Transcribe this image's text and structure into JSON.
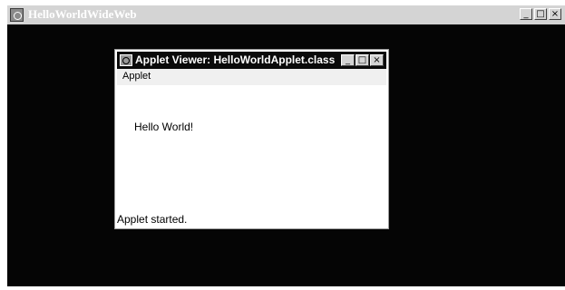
{
  "outer_window": {
    "title": "HelloWorldWideWeb",
    "icon": "java-cup-icon",
    "controls": {
      "minimize": "_",
      "maximize": "□",
      "close": "×"
    }
  },
  "applet_viewer": {
    "title": "Applet Viewer: HelloWorldApplet.class",
    "icon": "java-cup-icon",
    "controls": {
      "minimize": "_",
      "maximize": "□",
      "close": "×"
    },
    "menu": [
      "Applet"
    ],
    "content_text": "Hello World!",
    "status": "Applet started."
  },
  "colors": {
    "outer_background": "#050505",
    "viewer_titlebar": "#0a0a0a",
    "outer_titlebar": "#d4d4d4"
  }
}
